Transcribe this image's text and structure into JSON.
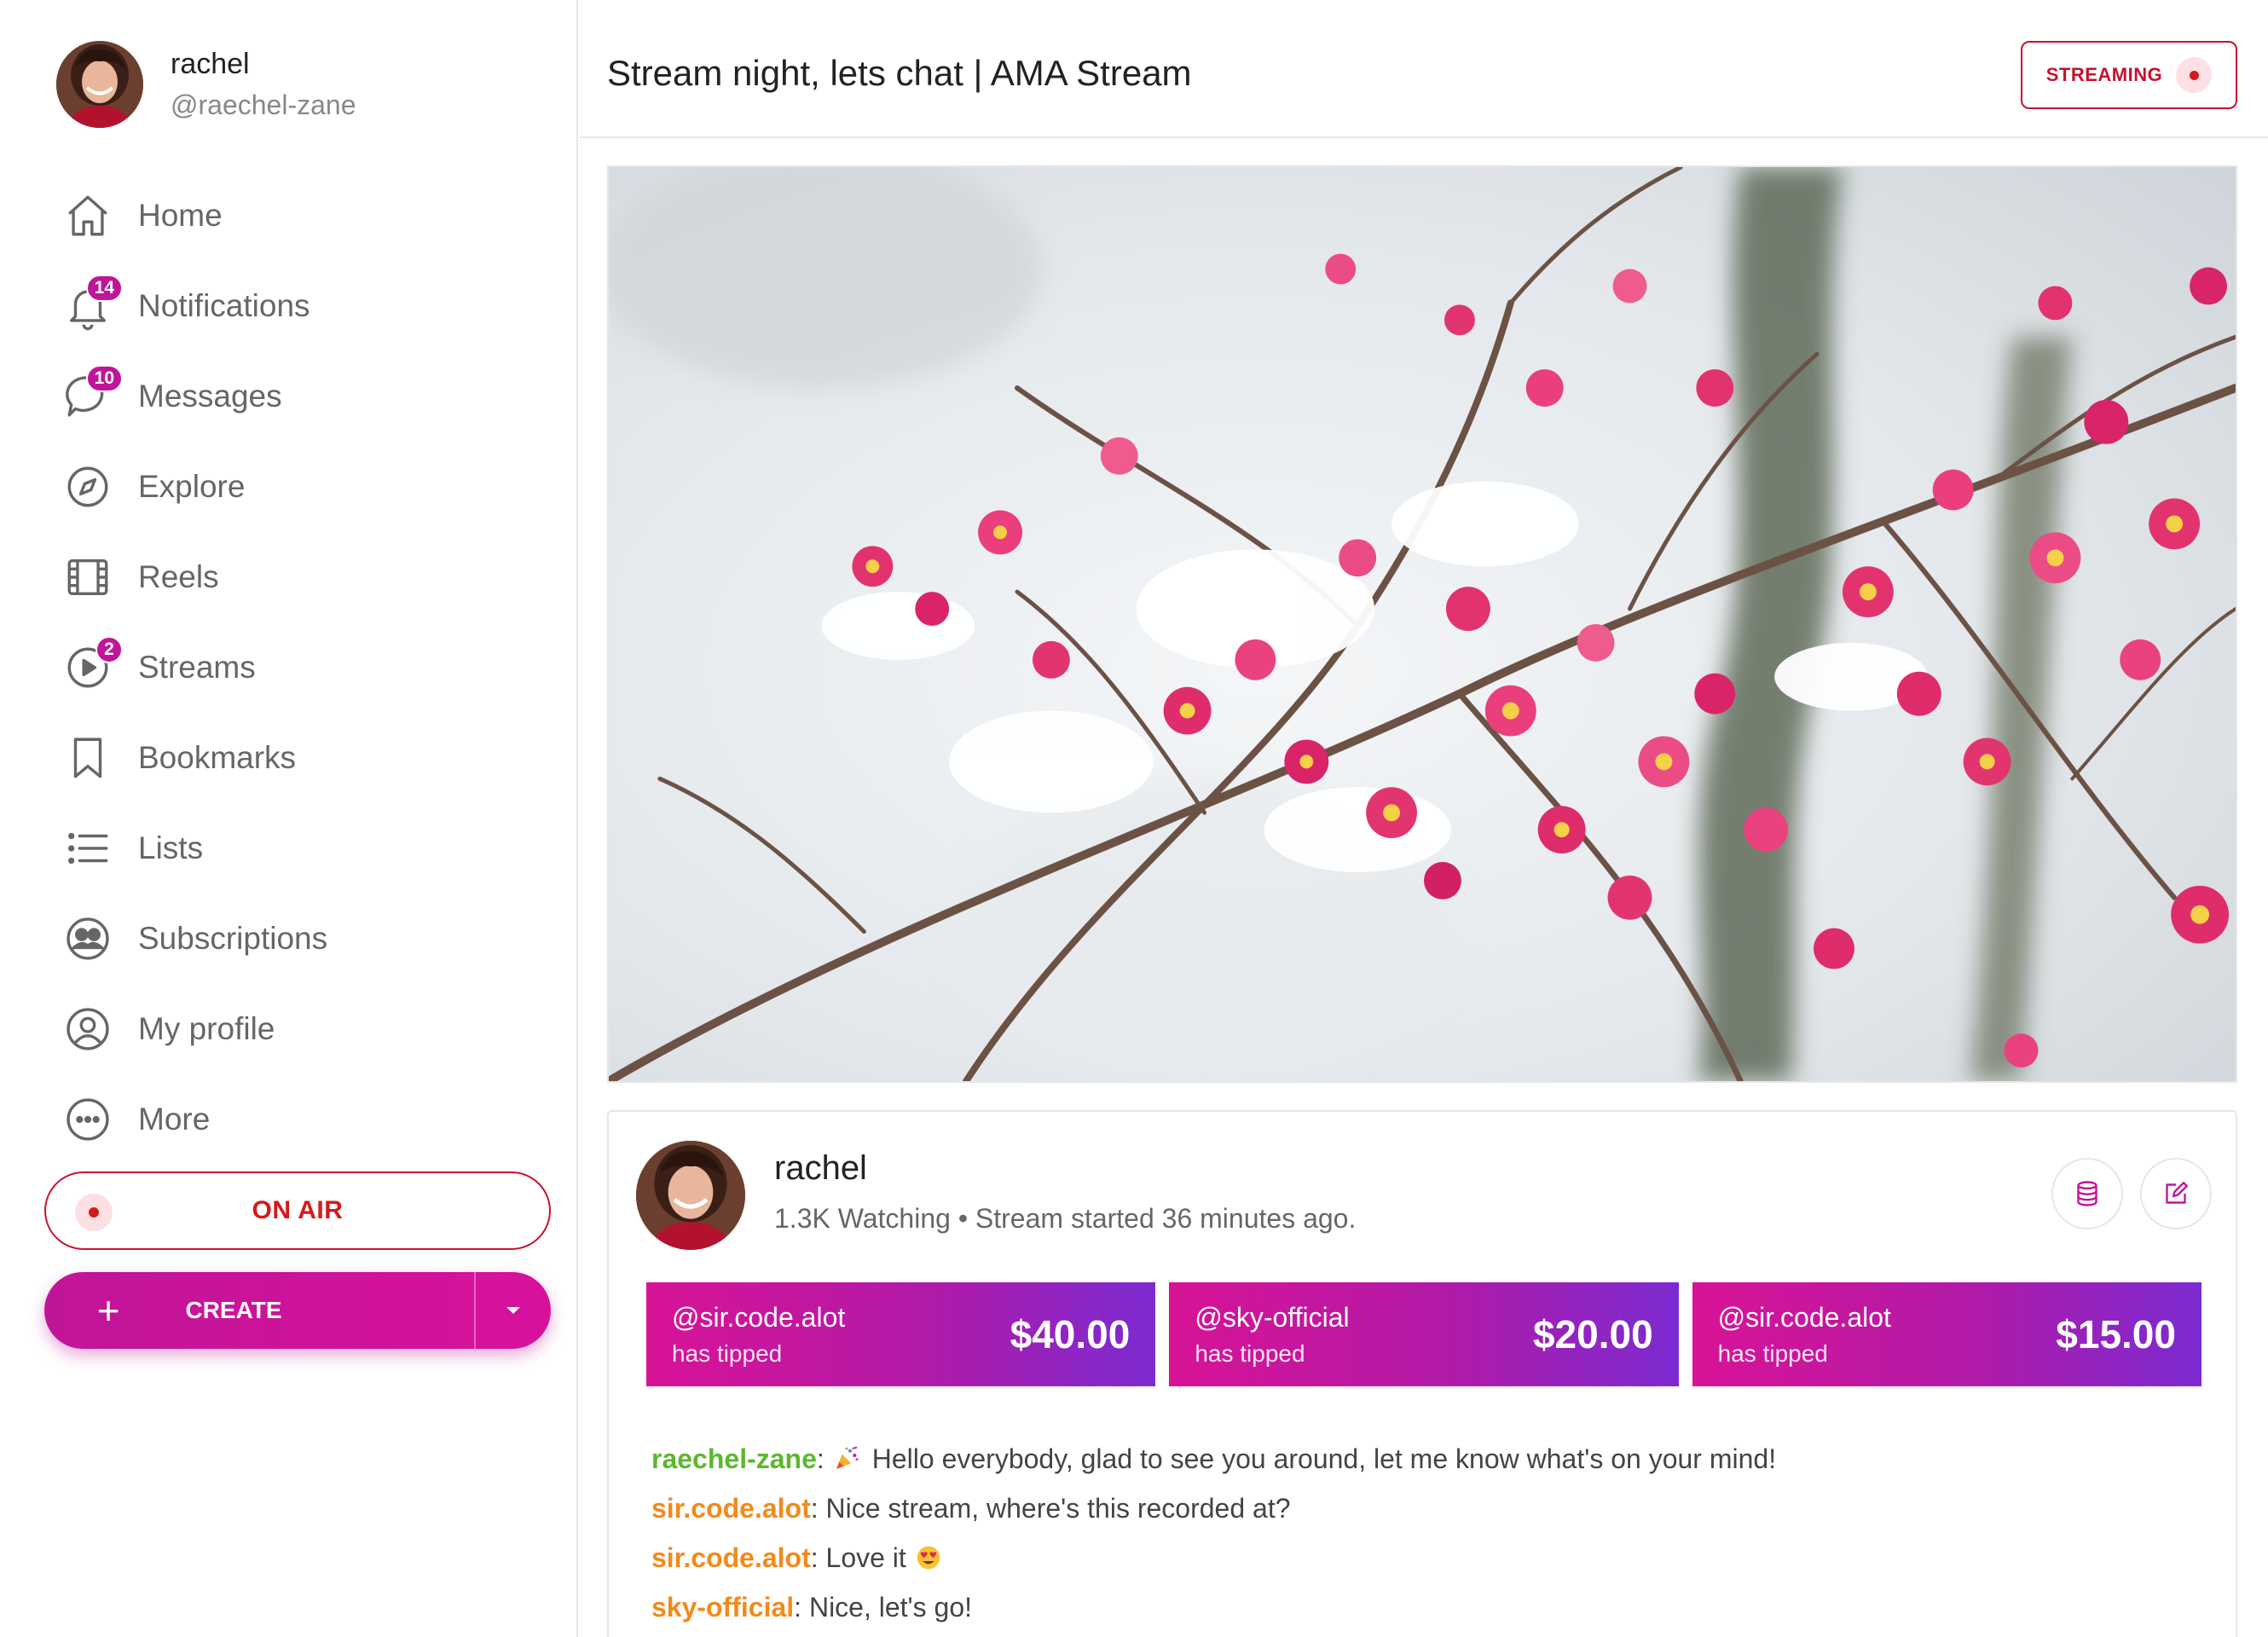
{
  "colors": {
    "accent": "#c01598",
    "live_red": "#d41a1a",
    "host_chat": "#5cb82e",
    "viewer_chat": "#f28a1c"
  },
  "profile": {
    "name": "rachel",
    "handle": "@raechel-zane"
  },
  "nav": [
    {
      "label": "Home",
      "icon": "home-icon"
    },
    {
      "label": "Notifications",
      "icon": "bell-icon",
      "badge": "14"
    },
    {
      "label": "Messages",
      "icon": "chat-bubble-icon",
      "badge": "10"
    },
    {
      "label": "Explore",
      "icon": "compass-icon"
    },
    {
      "label": "Reels",
      "icon": "film-icon"
    },
    {
      "label": "Streams",
      "icon": "play-circle-icon",
      "badge": "2"
    },
    {
      "label": "Bookmarks",
      "icon": "bookmark-icon"
    },
    {
      "label": "Lists",
      "icon": "list-icon"
    },
    {
      "label": "Subscriptions",
      "icon": "users-icon"
    },
    {
      "label": "My profile",
      "icon": "user-circle-icon"
    },
    {
      "label": "More",
      "icon": "more-icon"
    }
  ],
  "on_air_label": "ON AIR",
  "create": {
    "label": "CREATE",
    "plus_icon": "plus-icon",
    "caret_icon": "caret-down-icon"
  },
  "header": {
    "title": "Stream night, lets chat | AMA Stream",
    "streaming_label": "STREAMING"
  },
  "stream": {
    "host_name": "rachel",
    "meta": "1.3K Watching • Stream started 36 minutes ago.",
    "actions": [
      "database-icon",
      "edit-icon"
    ]
  },
  "tips": [
    {
      "user": "@sir.code.alot",
      "sub": "has tipped",
      "amount": "$40.00"
    },
    {
      "user": "@sky-official",
      "sub": "has tipped",
      "amount": "$20.00"
    },
    {
      "user": "@sir.code.alot",
      "sub": "has tipped",
      "amount": "$15.00"
    }
  ],
  "chat": [
    {
      "user": "raechel-zane",
      "role": "host",
      "emoji": "party-popper-emoji",
      "text": "Hello everybody, glad to see you around, let me know what's on your mind!"
    },
    {
      "user": "sir.code.alot",
      "role": "viewer",
      "text": "Nice stream, where's this recorded at?"
    },
    {
      "user": "sir.code.alot",
      "role": "viewer",
      "text": "Love it",
      "emoji_after": "heart-eyes-emoji"
    },
    {
      "user": "sky-official",
      "role": "viewer",
      "text": "Nice, let's go!"
    }
  ]
}
